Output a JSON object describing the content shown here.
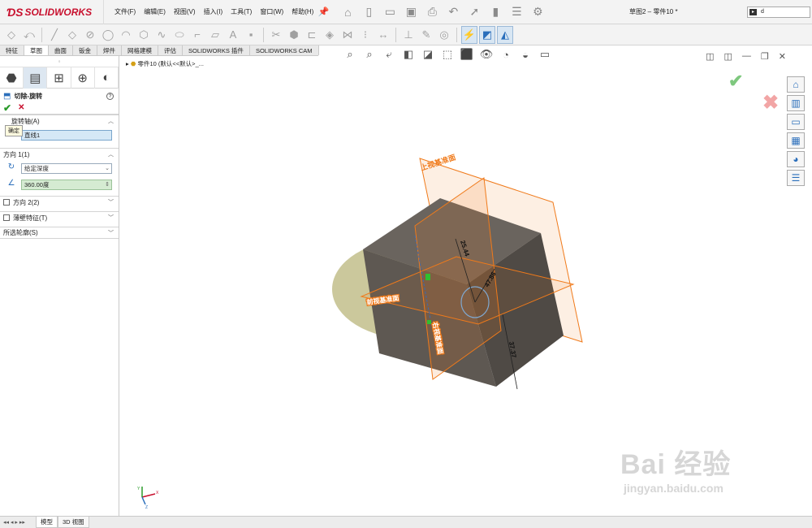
{
  "app": {
    "logo_text": "SOLIDWORKS",
    "document_title": "草图2 – 零件10 *",
    "search_value": "d"
  },
  "menu": [
    "文件(F)",
    "编辑(E)",
    "视图(V)",
    "插入(I)",
    "工具(T)",
    "窗口(W)",
    "帮助(H)"
  ],
  "tabs": [
    "特征",
    "草图",
    "曲面",
    "钣金",
    "焊件",
    "网格建模",
    "评估",
    "SOLIDWORKS 插件",
    "SOLIDWORKS CAM"
  ],
  "selected_tab": "草图",
  "property_manager": {
    "title": "切除-旋转",
    "help": "?",
    "tooltip": "确定",
    "axis_section": "旋转轴(A)",
    "axis_value": "直线1",
    "direction1_section": "方向 1(1)",
    "end_condition": "给定深度",
    "angle": "360.00度",
    "direction2_section": "方向 2(2)",
    "thin_feature_section": "薄壁特征(T)",
    "contours_section": "所选轮廓(S)"
  },
  "viewport": {
    "feature_tree_root": "零件10 (默认<<默认>_...",
    "plane_label_top": "上视基准面",
    "plane_label_left": "前视基准面",
    "plane_label_right": "右视基准面",
    "dim_a": "25.44",
    "dim_b": "47.86",
    "dim_c": "37.37",
    "triad_x": "X",
    "triad_y": "Y",
    "triad_z": "Z"
  },
  "watermark": {
    "main": "Bai 经验",
    "sub": "jingyan.baidu.com"
  },
  "bottom_tabs": [
    "模型",
    "3D 视图"
  ],
  "colors": {
    "accent": "#2a6ebb",
    "logo_red": "#c8102e",
    "plane_orange": "#f07a1a",
    "solid_body": "#5e5852",
    "revolve_preview": "#a09a4a"
  }
}
